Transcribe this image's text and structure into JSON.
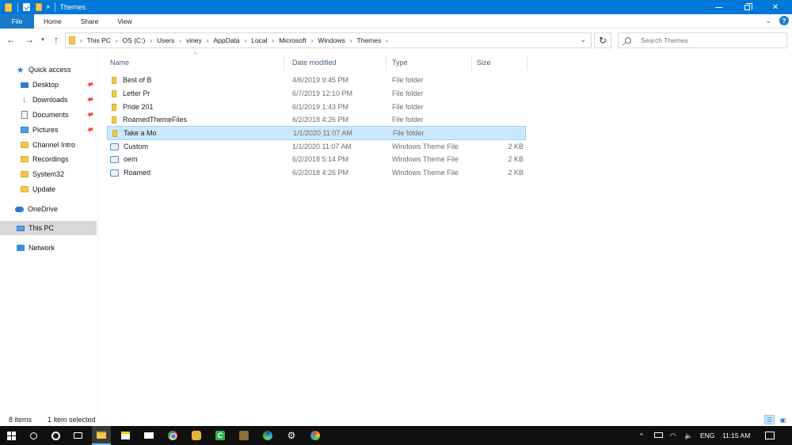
{
  "window": {
    "title": "Themes",
    "qa_dropdown": "▾"
  },
  "ribbon": {
    "tabs": [
      "File",
      "Home",
      "Share",
      "View"
    ],
    "collapse_chevron": "⌄",
    "help_label": "?"
  },
  "nav": {
    "back_icon": "←",
    "forward_icon": "→",
    "recent_icon": "▾",
    "up_icon": "↑",
    "breadcrumbs": [
      "This PC",
      "OS (C:)",
      "Users",
      "viney",
      "AppData",
      "Local",
      "Microsoft",
      "Windows",
      "Themes"
    ],
    "crumb_separator": "›",
    "address_dropdown": "⌄",
    "refresh_icon": "↻",
    "search_placeholder": "Search Themes"
  },
  "navigation_pane": {
    "items": [
      {
        "label": "Quick access",
        "icon": "star-icon",
        "pinned": false
      },
      {
        "label": "Desktop",
        "icon": "desktop-icon",
        "pinned": true
      },
      {
        "label": "Downloads",
        "icon": "download-icon",
        "pinned": true
      },
      {
        "label": "Documents",
        "icon": "documents-icon",
        "pinned": true
      },
      {
        "label": "Pictures",
        "icon": "pictures-icon",
        "pinned": true
      },
      {
        "label": "Channel Intro",
        "icon": "folder-icon",
        "pinned": false
      },
      {
        "label": "Recordings",
        "icon": "folder-icon",
        "pinned": false
      },
      {
        "label": "System32",
        "icon": "folder-icon",
        "pinned": false
      },
      {
        "label": "Update",
        "icon": "folder-icon",
        "pinned": false
      },
      {
        "label": "OneDrive",
        "icon": "cloud-icon",
        "pinned": false
      },
      {
        "label": "This PC",
        "icon": "computer-icon",
        "pinned": false,
        "selected": true
      },
      {
        "label": "Network",
        "icon": "network-icon",
        "pinned": false
      }
    ],
    "pin_glyph": "📌"
  },
  "file_list": {
    "columns": [
      "Name",
      "Date modified",
      "Type",
      "Size"
    ],
    "sort_indicator": "^",
    "rows": [
      {
        "name": "Best of B",
        "date": "4/6/2019 9:45 PM",
        "type": "File folder",
        "size": "",
        "kind": "folder"
      },
      {
        "name": "Letter Pr",
        "date": "6/7/2019 12:10 PM",
        "type": "File folder",
        "size": "",
        "kind": "folder"
      },
      {
        "name": "Pride 201",
        "date": "6/1/2019 1:43 PM",
        "type": "File folder",
        "size": "",
        "kind": "folder"
      },
      {
        "name": "RoamedThemeFiles",
        "date": "6/2/2018 4:26 PM",
        "type": "File folder",
        "size": "",
        "kind": "folder"
      },
      {
        "name": "Take a Mo",
        "date": "1/1/2020 11:07 AM",
        "type": "File folder",
        "size": "",
        "kind": "folder",
        "selected": true
      },
      {
        "name": "Custom",
        "date": "1/1/2020 11:07 AM",
        "type": "Windows Theme File",
        "size": "2 KB",
        "kind": "theme"
      },
      {
        "name": "oem",
        "date": "6/2/2018 5:14 PM",
        "type": "Windows Theme File",
        "size": "2 KB",
        "kind": "theme"
      },
      {
        "name": "Roamed",
        "date": "6/2/2018 4:26 PM",
        "type": "Windows Theme File",
        "size": "2 KB",
        "kind": "theme"
      }
    ]
  },
  "status_bar": {
    "item_count": "8 items",
    "selection": "1 item selected"
  },
  "taskbar": {
    "camtasia_letter": "C",
    "gear_glyph": "⚙",
    "tray": {
      "overflow": "^",
      "language": "ENG",
      "time": "11:15 AM"
    }
  },
  "colors": {
    "titlebar": "#0078d7",
    "selection": "#cce8ff",
    "taskbar": "#101010"
  }
}
